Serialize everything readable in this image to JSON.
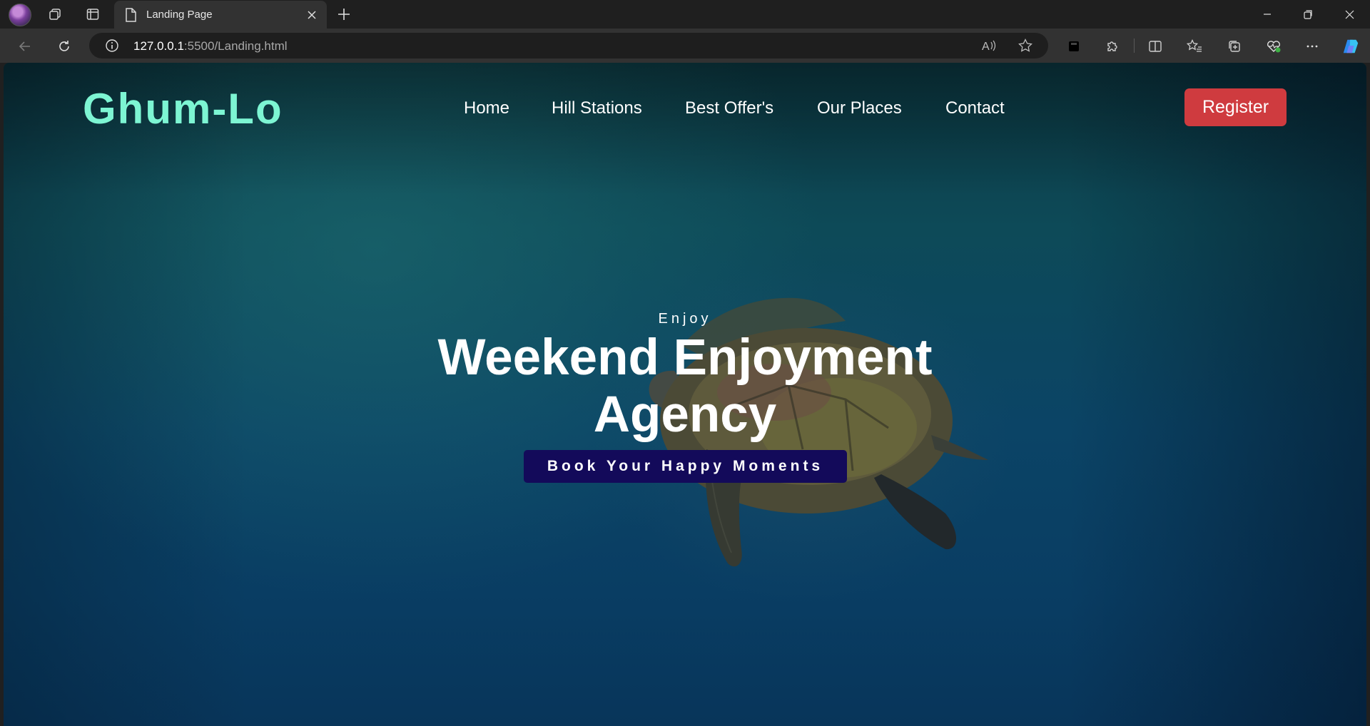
{
  "browser": {
    "tab": {
      "title": "Landing Page"
    },
    "address": {
      "host": "127.0.0.1",
      "path": ":5500/Landing.html"
    }
  },
  "site": {
    "brand": "Ghum-Lo",
    "nav": [
      "Home",
      "Hill Stations",
      "Best Offer's",
      "Our Places",
      "Contact"
    ],
    "register_label": "Register",
    "hero": {
      "eyebrow": "Enjoy",
      "title_line1": "Weekend Enjoyment",
      "title_line2": "Agency",
      "cta_label": "Book Your Happy Moments"
    }
  },
  "colors": {
    "brand": "#7df5d3",
    "register": "#cf3b3f",
    "cta": "#130a5a"
  }
}
